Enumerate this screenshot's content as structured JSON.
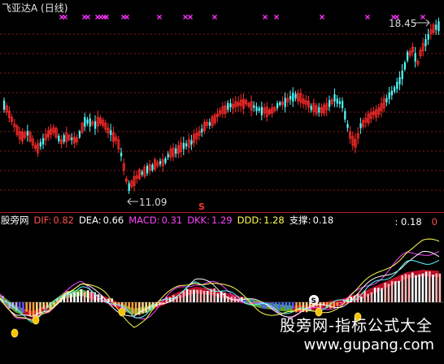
{
  "price_panel": {
    "title": "飞亚达A (日线)",
    "high_label": "18.45",
    "low_label": "11.09",
    "signal_mark": "S",
    "colors": {
      "up": "#ff2b2b",
      "down": "#54ffff",
      "grid": "#8b1a1a",
      "cross": "#ff33ff",
      "arrow": "#cfcfcf"
    }
  },
  "indicator_panel": {
    "name": "股旁网",
    "dif_label": "DIF:",
    "dif_value": "0.82",
    "dea_label": "DEA:",
    "dea_value": "0.66",
    "macd_label": "MACD:",
    "macd_value": "0.31",
    "dkk_label": "DKK:",
    "dkk_value": "1.29",
    "ddd_label": "DDD:",
    "ddd_value": "1.28",
    "zc_label": "支撑:",
    "zc_value": "0.18",
    "right_value": ": 0.18",
    "right_zero": "0",
    "bubble_symbol": "S",
    "colors": {
      "dif": "#ff4d4d",
      "dea": "#ffffff",
      "macd": "#ff44ff",
      "dkk": "#ff44ff",
      "ddd": "#ffff55",
      "zc": "#ffffff"
    }
  },
  "watermark": {
    "text": "股旁网-指标公式大全",
    "url": "www.gupang.com"
  }
}
